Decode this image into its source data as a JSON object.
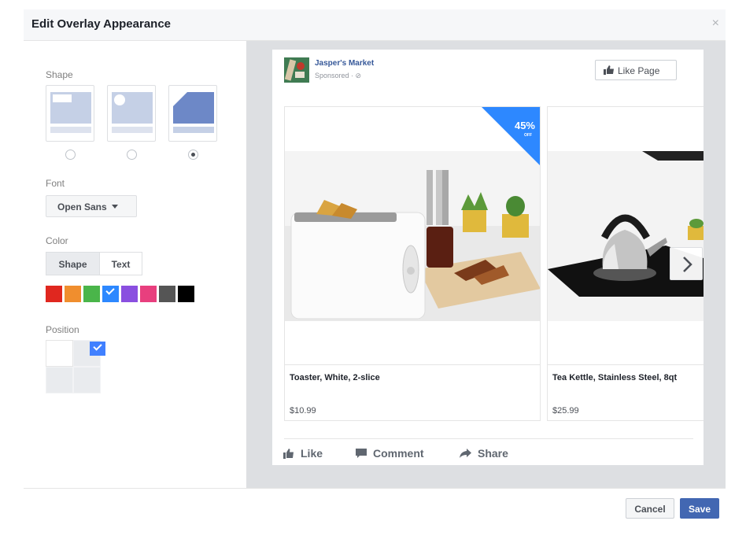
{
  "dialog": {
    "title": "Edit Overlay Appearance",
    "close_icon": "×"
  },
  "left_panel": {
    "shape_label": "Shape",
    "shape_options": [
      {
        "name": "rectangle",
        "selected": false
      },
      {
        "name": "circle",
        "selected": false
      },
      {
        "name": "triangle",
        "selected": true
      }
    ],
    "font_label": "Font",
    "font_value": "Open Sans",
    "color_label": "Color",
    "color_tabs": [
      {
        "label": "Shape",
        "active": true
      },
      {
        "label": "Text",
        "active": false
      }
    ],
    "swatches": [
      "#e0271f",
      "#f08e2e",
      "#4ab54a",
      "#2d88ff",
      "#8a4fe0",
      "#e83f7e",
      "#555555",
      "#000000"
    ],
    "selected_swatch": "#2d88ff",
    "position_label": "Position",
    "position_selected": "top-right"
  },
  "post": {
    "page_name": "Jasper's Market",
    "sponsored": "Sponsored · ⊘",
    "like_page_label": "Like Page",
    "discount_overlay": {
      "text": "45%",
      "sub": "OFF",
      "color": "#2d88ff"
    },
    "products": [
      {
        "title": "Toaster, White, 2-slice",
        "price": "$10.99"
      },
      {
        "title": "Tea Kettle, Stainless Steel, 8qt",
        "price": "$25.99"
      }
    ],
    "actions": [
      {
        "label": "Like",
        "icon": "thumbs-up-icon"
      },
      {
        "label": "Comment",
        "icon": "comment-icon"
      },
      {
        "label": "Share",
        "icon": "share-icon"
      }
    ]
  },
  "footer": {
    "cancel_label": "Cancel",
    "save_label": "Save"
  },
  "colors": {
    "brand_blue": "#4267b2",
    "link_blue": "#365899",
    "overlay_blue": "#2d88ff"
  }
}
